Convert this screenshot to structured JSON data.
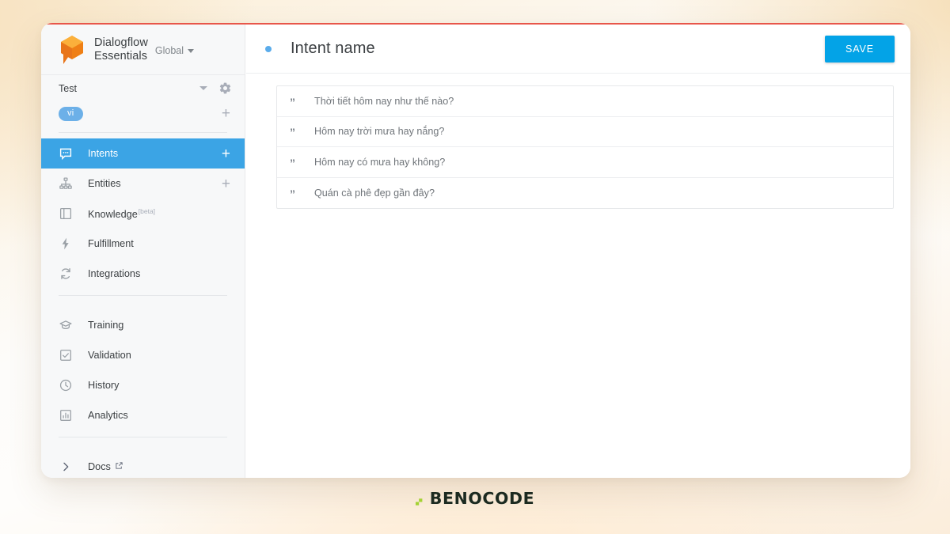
{
  "brand": {
    "logo_icon": "dialogflow-cube-icon",
    "name_line1": "Dialogflow",
    "name_line2": "Essentials",
    "region": "Global",
    "region_caret_icon": "caret-down-icon"
  },
  "sidebar": {
    "agent": {
      "name": "Test",
      "caret_icon": "caret-down-icon",
      "settings_icon": "gear-icon"
    },
    "language": {
      "code": "vi",
      "add_icon": "plus-icon"
    },
    "nav_groups": [
      {
        "items": [
          {
            "label": "Intents",
            "icon": "speech-bubble-icon",
            "active": true,
            "trailing_icon": "plus-icon"
          },
          {
            "label": "Entities",
            "icon": "hierarchy-icon",
            "active": false,
            "trailing_icon": "plus-icon"
          },
          {
            "label": "Knowledge",
            "badge": "[beta]",
            "icon": "book-icon",
            "active": false
          },
          {
            "label": "Fulfillment",
            "icon": "lightning-bolt-icon",
            "active": false
          },
          {
            "label": "Integrations",
            "icon": "refresh-arrows-icon",
            "active": false
          }
        ]
      },
      {
        "items": [
          {
            "label": "Training",
            "icon": "graduation-cap-icon",
            "active": false
          },
          {
            "label": "Validation",
            "icon": "checkbox-icon",
            "active": false
          },
          {
            "label": "History",
            "icon": "clock-icon",
            "active": false
          },
          {
            "label": "Analytics",
            "icon": "bar-chart-icon",
            "active": false
          }
        ]
      },
      {
        "items": [
          {
            "label": "Docs",
            "icon": "chevron-right-icon",
            "active": false,
            "external_icon": "external-link-icon"
          }
        ]
      }
    ]
  },
  "main": {
    "header": {
      "status_dot_color": "#5aaceb",
      "title": "Intent name",
      "save_label": "SAVE"
    },
    "training_phrases": {
      "quote_icon": "quote-icon",
      "rows": [
        {
          "text": "Thời tiết hôm nay như thế nào?"
        },
        {
          "text": "Hôm nay trời mưa hay nắng?"
        },
        {
          "text": "Hôm nay có mưa hay không?"
        },
        {
          "text": "Quán cà phê đẹp gần đây?"
        }
      ]
    }
  },
  "footer": {
    "mark_icon": "benocode-accent-icon",
    "brand": "BENOCODE"
  },
  "colors": {
    "accent_blue": "#03a3e7",
    "active_nav_blue": "#3ba4e5",
    "lang_chip_blue": "#6cb0e8",
    "top_line_red": "#e8564a",
    "logo_orange": "#f89c1c",
    "logo_orange_dark": "#e8751a",
    "footer_green": "#a4d233",
    "footer_text": "#1c2a20"
  }
}
